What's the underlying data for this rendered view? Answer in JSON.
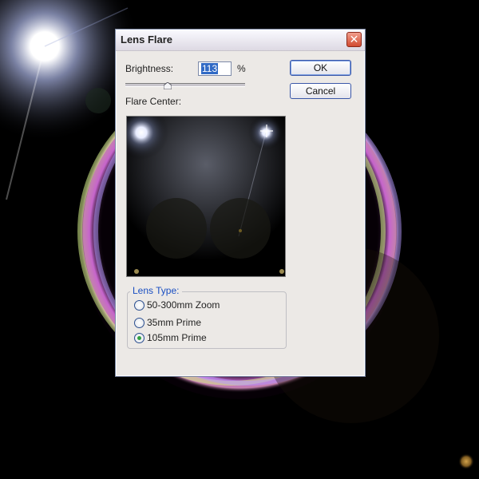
{
  "dialog": {
    "title": "Lens Flare",
    "close_glyph": "✕",
    "brightness_label": "Brightness:",
    "brightness_value": "113",
    "brightness_unit": "%",
    "flare_center_label": "Flare Center:",
    "ok_label": "OK",
    "cancel_label": "Cancel",
    "lens_type_label": "Lens Type:",
    "lens_types": [
      {
        "label": "50-300mm Zoom",
        "selected": false
      },
      {
        "label": "35mm Prime",
        "selected": false
      },
      {
        "label": "105mm Prime",
        "selected": true
      }
    ]
  }
}
